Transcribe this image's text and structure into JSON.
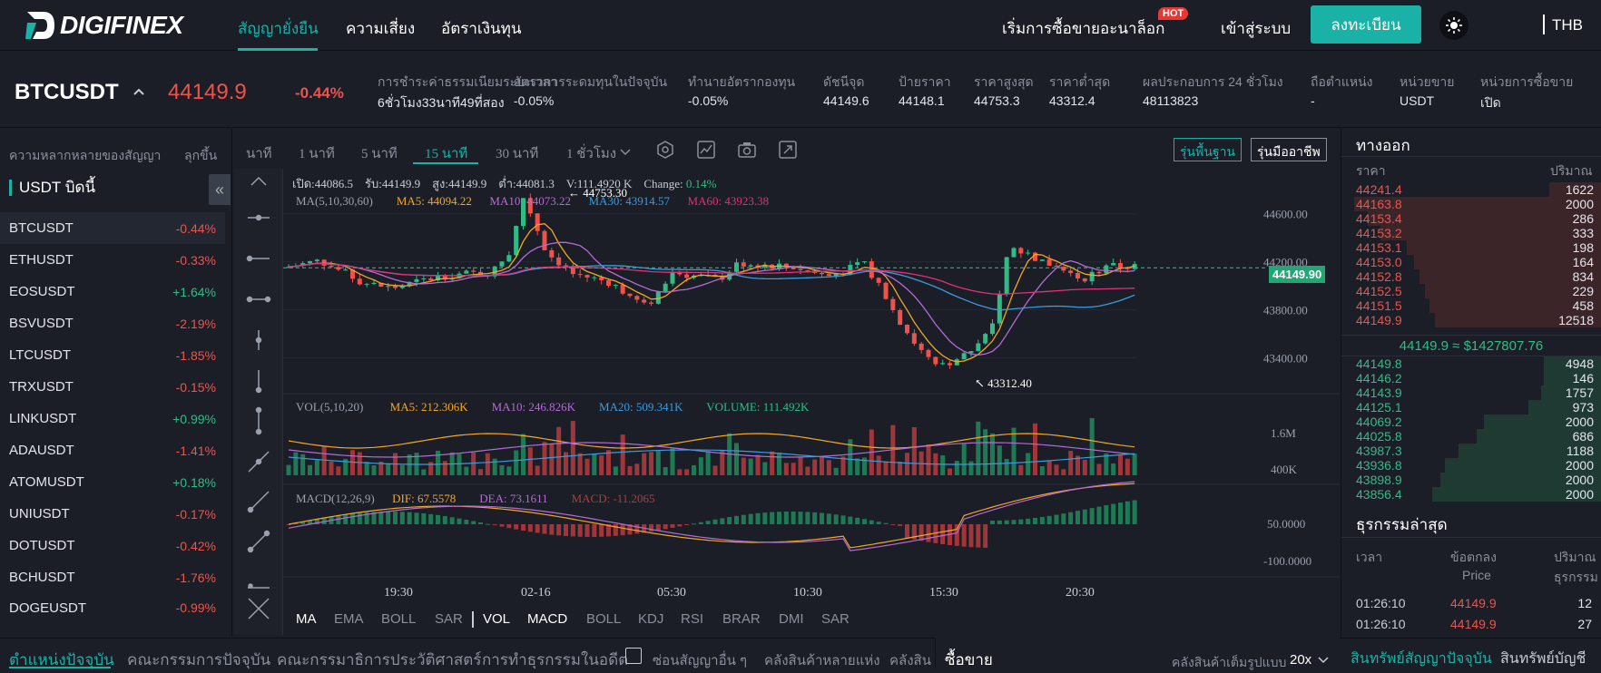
{
  "brand": {
    "name": "DIGIFINEX",
    "accent": "#1ab2a6"
  },
  "topnav": {
    "links": [
      "สัญญายั่งยืน",
      "ความเสี่ยง",
      "อัตราเงินทุน"
    ],
    "right": {
      "sim_trade": "เริ่มการซื้อขายอะนาล็อก",
      "hot": "HOT",
      "login": "เข้าสู่ระบบ",
      "register": "ลงทะเบียน",
      "currency": "THB"
    }
  },
  "ticker": {
    "symbol": "BTCUSDT",
    "price": "44149.9",
    "change_pct": "-0.44%",
    "stats": [
      {
        "label": "การชำระค่าธรรมเนียมระยะเวลา",
        "value": "6ชั่วโมง33นาที49ที่สอง"
      },
      {
        "label": "อัตราการระดมทุนในปัจจุบัน",
        "value": "-0.05%"
      },
      {
        "label": "ทำนายอัตรากองทุน",
        "value": "-0.05%"
      },
      {
        "label": "ดัชนีจุด",
        "value": "44149.6"
      },
      {
        "label": "ป้ายราคา",
        "value": "44148.1"
      },
      {
        "label": "ราคาสูงสุด",
        "value": "44753.3"
      },
      {
        "label": "ราคาต่ำสุด",
        "value": "43312.4"
      },
      {
        "label": "ผลประกอบการ 24 ชั่วโมง",
        "value": "48113823"
      },
      {
        "label": "ถือตำแหน่ง",
        "value": "-"
      },
      {
        "label": "หน่วยขาย",
        "value": "USDT"
      },
      {
        "label": "หน่วยการซื้อขาย",
        "value": "เปิด"
      }
    ]
  },
  "markets": {
    "header_left": "ความหลากหลายของสัญญา",
    "header_right": "ลุกขึ้น",
    "group": "USDT บิดนี้",
    "items": [
      {
        "name": "BTCUSDT",
        "change": "-0.44%",
        "dir": "neg"
      },
      {
        "name": "ETHUSDT",
        "change": "-0.33%",
        "dir": "neg"
      },
      {
        "name": "EOSUSDT",
        "change": "+1.64%",
        "dir": "pos"
      },
      {
        "name": "BSVUSDT",
        "change": "-2.19%",
        "dir": "neg"
      },
      {
        "name": "LTCUSDT",
        "change": "-1.85%",
        "dir": "neg"
      },
      {
        "name": "TRXUSDT",
        "change": "-0.15%",
        "dir": "neg"
      },
      {
        "name": "LINKUSDT",
        "change": "+0.99%",
        "dir": "pos"
      },
      {
        "name": "ADAUSDT",
        "change": "-1.41%",
        "dir": "neg"
      },
      {
        "name": "ATOMUSDT",
        "change": "+0.18%",
        "dir": "pos"
      },
      {
        "name": "UNIUSDT",
        "change": "-0.17%",
        "dir": "neg"
      },
      {
        "name": "DOTUSDT",
        "change": "-0.42%",
        "dir": "neg"
      },
      {
        "name": "BCHUSDT",
        "change": "-1.76%",
        "dir": "neg"
      },
      {
        "name": "DOGEUSDT",
        "change": "-0.99%",
        "dir": "neg"
      }
    ]
  },
  "chart": {
    "timeframes": [
      "นาที",
      "1 นาที",
      "5 นาที",
      "15 นาที",
      "30 นาที",
      "1 ชั่วโมง"
    ],
    "active_timeframe": "15 นาที",
    "versions": [
      "รุ่นพื้นฐาน",
      "รุ่นมืออาชีพ"
    ],
    "ohlc_line": {
      "open": "เปิด:44086.5",
      "close": "รับ:44149.9",
      "high": "สูง:44149.9",
      "low": "ต่ำ:44081.3",
      "vol": "V:111.4920 K",
      "change_label": "Change:",
      "change_val": "0.14%"
    },
    "ma_line": {
      "label": "MA(5,10,30,60)",
      "ma5": "MA5: 44094.22",
      "ma10": "MA10: 44073.22",
      "ma30": "MA30: 43914.57",
      "ma60": "MA60: 43923.38"
    },
    "vol_line": {
      "label": "VOL(5,10,20)",
      "ma5": "MA5: 212.306K",
      "ma10": "MA10: 246.826K",
      "ma20": "MA20: 509.341K",
      "volume": "VOLUME: 111.492K"
    },
    "macd_line": {
      "label": "MACD(12,26,9)",
      "dif": "DIF: 67.5578",
      "dea": "DEA: 73.1611",
      "macd": "MACD: -11.2065"
    },
    "high_marker": "44753.30",
    "low_marker": "43312.40",
    "last_price_tag": "44149.90",
    "y_ticks": [
      "44600.00",
      "44200.00",
      "43800.00",
      "43400.00"
    ],
    "vol_ticks": [
      "1.6M",
      "400K"
    ],
    "macd_ticks": [
      "50.0000",
      "-100.0000"
    ],
    "x_ticks": [
      "19:30",
      "02-16",
      "05:30",
      "10:30",
      "15:30",
      "20:30"
    ],
    "indicator_tabs": [
      "MA",
      "EMA",
      "BOLL",
      "SAR",
      "VOL",
      "MACD",
      "BOLL",
      "KDJ",
      "RSI",
      "BRAR",
      "DMI",
      "SAR"
    ],
    "colors": {
      "up": "#2ebd85",
      "down": "#f0524a",
      "ma5": "#f5a623",
      "ma10": "#b36bd4",
      "ma30": "#3b9be0",
      "ma60": "#e0307a"
    }
  },
  "chart_data": {
    "type": "candlestick",
    "x_ticks": [
      "19:30",
      "02-16",
      "05:30",
      "10:30",
      "15:30",
      "20:30"
    ],
    "ylim": [
      43200,
      44900
    ],
    "high": 44753.3,
    "low": 43312.4,
    "last": 44149.9
  },
  "orderbook": {
    "title": "ทางออก",
    "price_header": "ราคา",
    "qty_header": "ปริมาณ",
    "asks": [
      {
        "p": "44241.4",
        "q": "1622",
        "f": 0.2
      },
      {
        "p": "44163.8",
        "q": "2000",
        "f": 0.95
      },
      {
        "p": "44153.4",
        "q": "286",
        "f": 0.9
      },
      {
        "p": "44153.2",
        "q": "333",
        "f": 0.85
      },
      {
        "p": "44153.1",
        "q": "198",
        "f": 0.75
      },
      {
        "p": "44153.0",
        "q": "164",
        "f": 0.72
      },
      {
        "p": "44152.8",
        "q": "834",
        "f": 0.7
      },
      {
        "p": "44152.5",
        "q": "229",
        "f": 0.68
      },
      {
        "p": "44151.5",
        "q": "458",
        "f": 0.66
      },
      {
        "p": "44149.9",
        "q": "12518",
        "f": 0.64
      }
    ],
    "mid": "44149.9 ≈ $1427807.76",
    "bids": [
      {
        "p": "44149.8",
        "q": "4948",
        "f": 0.22
      },
      {
        "p": "44146.2",
        "q": "146",
        "f": 0.22
      },
      {
        "p": "44143.9",
        "q": "1757",
        "f": 0.23
      },
      {
        "p": "44125.1",
        "q": "973",
        "f": 0.28
      },
      {
        "p": "44069.2",
        "q": "2000",
        "f": 0.45
      },
      {
        "p": "44025.8",
        "q": "686",
        "f": 0.48
      },
      {
        "p": "43987.3",
        "q": "1188",
        "f": 0.55
      },
      {
        "p": "43936.8",
        "q": "2000",
        "f": 0.6
      },
      {
        "p": "43898.9",
        "q": "2000",
        "f": 0.62
      },
      {
        "p": "43856.4",
        "q": "2000",
        "f": 0.65
      }
    ]
  },
  "trades": {
    "title": "ธุรกรรมล่าสุด",
    "time_header": "เวลา",
    "price_header": "ข้อตกลง",
    "price_sub": "Price",
    "qty_header": "ปริมาณ",
    "qty_sub": "ธุรกรรม",
    "rows": [
      {
        "t": "01:26:10",
        "p": "44149.9",
        "q": "12"
      },
      {
        "t": "01:26:10",
        "p": "44149.9",
        "q": "27"
      }
    ]
  },
  "bottom": {
    "tabs": [
      "ตำแหน่งปัจจุบัน",
      "คณะกรรมการปัจจุบัน",
      "คณะกรรมาธิการประวัติศาสตร์",
      "การทำธุรกรรมในอดีต"
    ],
    "hide_other": "ซ่อนสัญญาอื่น ๆ",
    "warehouse_multi": "คลังสินค้าหลายแห่ง",
    "warehouse_short": "คลังสิน",
    "trade_title": "ซื้อขาย",
    "full_mode": "คลังสินค้าเต็มรูปแบบ",
    "leverage": "20x",
    "assets_current": "สินทรัพย์สัญญาปัจจุบัน",
    "assets_account": "สินทรัพย์บัญชี"
  }
}
